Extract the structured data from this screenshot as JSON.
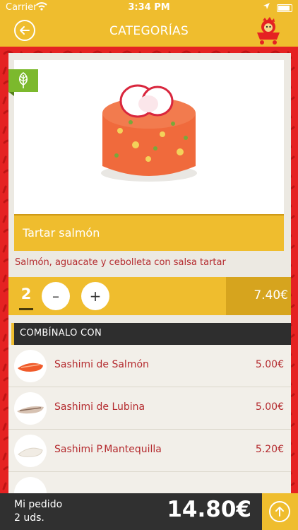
{
  "status_bar": {
    "carrier": "Carrier",
    "time": "3:34 PM"
  },
  "nav": {
    "title": "CATEGORÍAS",
    "back_icon": "arrow-left-circle-icon",
    "mascot_icon": "mascot-logo-icon"
  },
  "product": {
    "name": "Tartar salmón",
    "description": "Salmón, aguacate y cebolleta con salsa tartar",
    "badge_icon": "vegetarian-leaf-icon",
    "quantity": "2",
    "minus_label": "–",
    "plus_label": "+",
    "price": "7.40€"
  },
  "combine": {
    "header": "COMBÍNALO CON",
    "items": [
      {
        "name": "Sashimi de Salmón",
        "price": "5.00€"
      },
      {
        "name": "Sashimi de Lubina",
        "price": "5.00€"
      },
      {
        "name": "Sashimi P.Mantequilla",
        "price": "5.20€"
      }
    ]
  },
  "order": {
    "label": "Mi pedido",
    "count": "2 uds.",
    "total": "14.80€",
    "confirm_icon": "arrow-up-circle-icon"
  },
  "colors": {
    "yellow": "#efbd2e",
    "red": "#e52222",
    "dark": "#303030",
    "text_red": "#b42a2e",
    "green": "#7cb92d"
  }
}
